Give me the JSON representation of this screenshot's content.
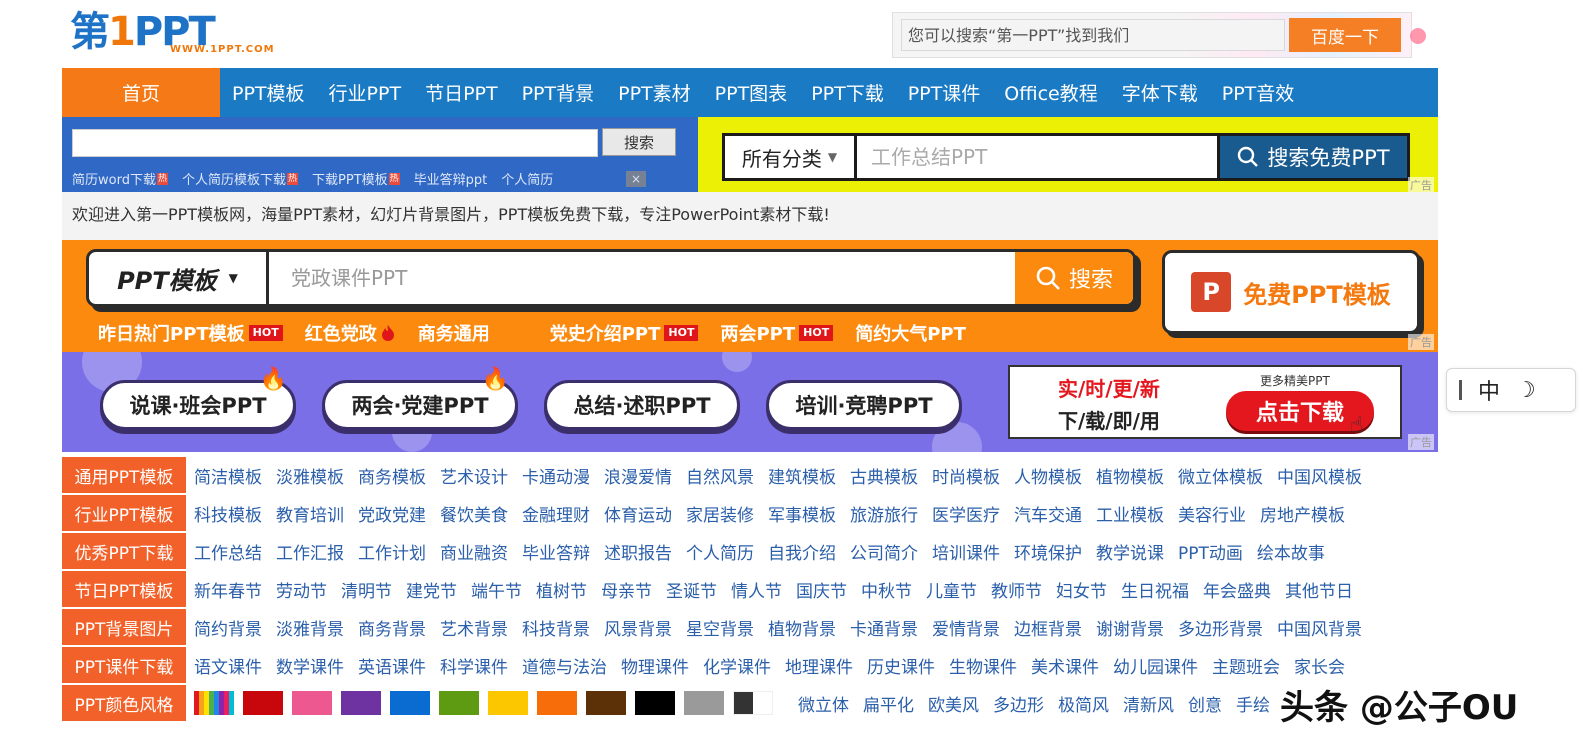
{
  "logo": {
    "main_text": "第",
    "one_text": "1",
    "tail_text": "PPT",
    "sub_text": "WWW.1PPT.COM"
  },
  "top_search": {
    "placeholder": "您可以搜索“第一PPT”找到我们",
    "button_label": "百度一下"
  },
  "nav": {
    "home": "首页",
    "items": [
      "PPT模板",
      "行业PPT",
      "节日PPT",
      "PPT背景",
      "PPT素材",
      "PPT图表",
      "PPT下载",
      "PPT课件",
      "Office教程",
      "字体下载",
      "PPT音效"
    ]
  },
  "blue_search": {
    "button_label": "搜索",
    "links": [
      "简历word下载",
      "个人简历模板下载",
      "下载PPT模板",
      "毕业答辩ppt",
      "个人简历"
    ],
    "hot_mini": "热",
    "close": "×"
  },
  "yellow_ad": {
    "category": "所有分类",
    "placeholder": "工作总结PPT",
    "button_label": "搜索免费PPT",
    "ad_tag": "广告"
  },
  "welcome": "欢迎进入第一PPT模板网，海量PPT素材，幻灯片背景图片，PPT模板免费下载，专注PowerPoint素材下载!",
  "orange_banner": {
    "category": "PPT模板",
    "placeholder": "党政课件PPT",
    "search_label": "搜索",
    "free_label": "免费PPT模板",
    "free_logo": "P",
    "hot_badge": "HOT",
    "tags": [
      {
        "text": "昨日热门PPT模板",
        "badge": "hot"
      },
      {
        "text": "红色党政",
        "badge": "fire"
      },
      {
        "text": "商务通用",
        "badge": ""
      },
      {
        "text": "党史介绍PPT",
        "badge": "hot"
      },
      {
        "text": "两会PPT",
        "badge": "hot"
      },
      {
        "text": "简约大气PPT",
        "badge": ""
      }
    ],
    "ad_tag": "广告"
  },
  "purple_banner": {
    "pills": [
      "说课·班会PPT",
      "两会·党建PPT",
      "总结·述职PPT",
      "培训·竞聘PPT"
    ],
    "ad_line1": "实/时/更/新",
    "ad_line2": "下/载/即/用",
    "ad_more": "更多精美PPT",
    "ad_button": "点击下载",
    "ad_tag": "广告"
  },
  "categories": [
    {
      "label": "通用PPT模板",
      "links": [
        "简洁模板",
        "淡雅模板",
        "商务模板",
        "艺术设计",
        "卡通动漫",
        "浪漫爱情",
        "自然风景",
        "建筑模板",
        "古典模板",
        "时尚模板",
        "人物模板",
        "植物模板",
        "微立体模板",
        "中国风模板"
      ]
    },
    {
      "label": "行业PPT模板",
      "links": [
        "科技模板",
        "教育培训",
        "党政党建",
        "餐饮美食",
        "金融理财",
        "体育运动",
        "家居装修",
        "军事模板",
        "旅游旅行",
        "医学医疗",
        "汽车交通",
        "工业模板",
        "美容行业",
        "房地产模板"
      ]
    },
    {
      "label": "优秀PPT下载",
      "links": [
        "工作总结",
        "工作汇报",
        "工作计划",
        "商业融资",
        "毕业答辩",
        "述职报告",
        "个人简历",
        "自我介绍",
        "公司简介",
        "培训课件",
        "环境保护",
        "教学说课",
        "PPT动画",
        "绘本故事"
      ]
    },
    {
      "label": "节日PPT模板",
      "links": [
        "新年春节",
        "劳动节",
        "清明节",
        "建党节",
        "端午节",
        "植树节",
        "母亲节",
        "圣诞节",
        "情人节",
        "国庆节",
        "中秋节",
        "儿童节",
        "教师节",
        "妇女节",
        "生日祝福",
        "年会盛典",
        "其他节日"
      ]
    },
    {
      "label": "PPT背景图片",
      "links": [
        "简约背景",
        "淡雅背景",
        "商务背景",
        "艺术背景",
        "科技背景",
        "风景背景",
        "星空背景",
        "植物背景",
        "卡通背景",
        "爱情背景",
        "边框背景",
        "谢谢背景",
        "多边形背景",
        "中国风背景"
      ]
    },
    {
      "label": "PPT课件下载",
      "links": [
        "语文课件",
        "数学课件",
        "英语课件",
        "科学课件",
        "道德与法治",
        "物理课件",
        "化学课件",
        "地理课件",
        "历史课件",
        "生物课件",
        "美术课件",
        "幼儿园课件",
        "主题班会",
        "家长会"
      ]
    }
  ],
  "color_row": {
    "label": "PPT颜色风格",
    "swatches": [
      "multi",
      "#c8070c",
      "#ee5891",
      "#6e33a0",
      "#0a6bd0",
      "#5f9b12",
      "#fdc700",
      "#f76d0a",
      "#5c3108",
      "#000000",
      "#9a9a9a",
      "bw"
    ],
    "links": [
      "微立体",
      "扁平化",
      "欧美风",
      "多边形",
      "极简风",
      "清新风",
      "创意",
      "手绘"
    ]
  },
  "float_tool": {
    "zh": "中",
    "moon": "☽"
  },
  "watermark": "头条 @公子OU"
}
